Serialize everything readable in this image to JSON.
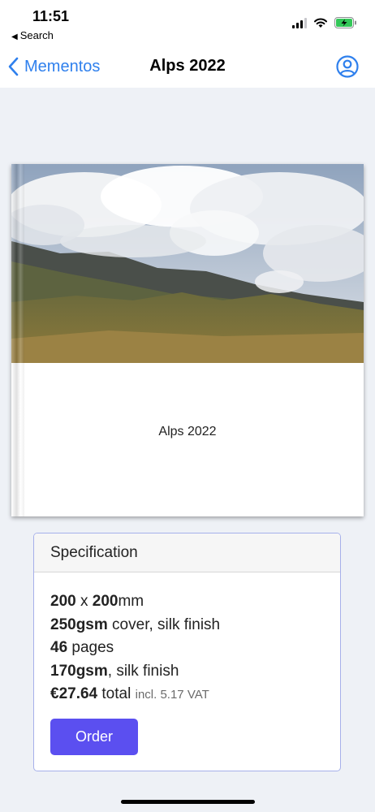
{
  "status_bar": {
    "time": "11:51",
    "back_app_label": "Search",
    "icons": [
      "cellular-signal-icon",
      "wifi-icon",
      "battery-charging-icon"
    ]
  },
  "nav": {
    "back_label": "Mementos",
    "title": "Alps 2022",
    "account_icon": "user-circle-icon",
    "accent_color": "#2f80ed"
  },
  "book": {
    "cover_title": "Alps 2022",
    "cover_image": "mountain landscape with clouds"
  },
  "specification": {
    "header": "Specification",
    "size_w": "200",
    "size_x": " x ",
    "size_h": "200",
    "size_unit": "mm",
    "cover_weight": "250gsm",
    "cover_rest": " cover, silk finish",
    "page_count": "46",
    "pages_rest": " pages",
    "paper_weight": "170gsm",
    "paper_rest": ", silk finish",
    "price": "€27.64",
    "price_total": " total ",
    "vat_note": "incl. 5.17 VAT",
    "order_label": "Order",
    "order_color": "#5b4ff0"
  }
}
